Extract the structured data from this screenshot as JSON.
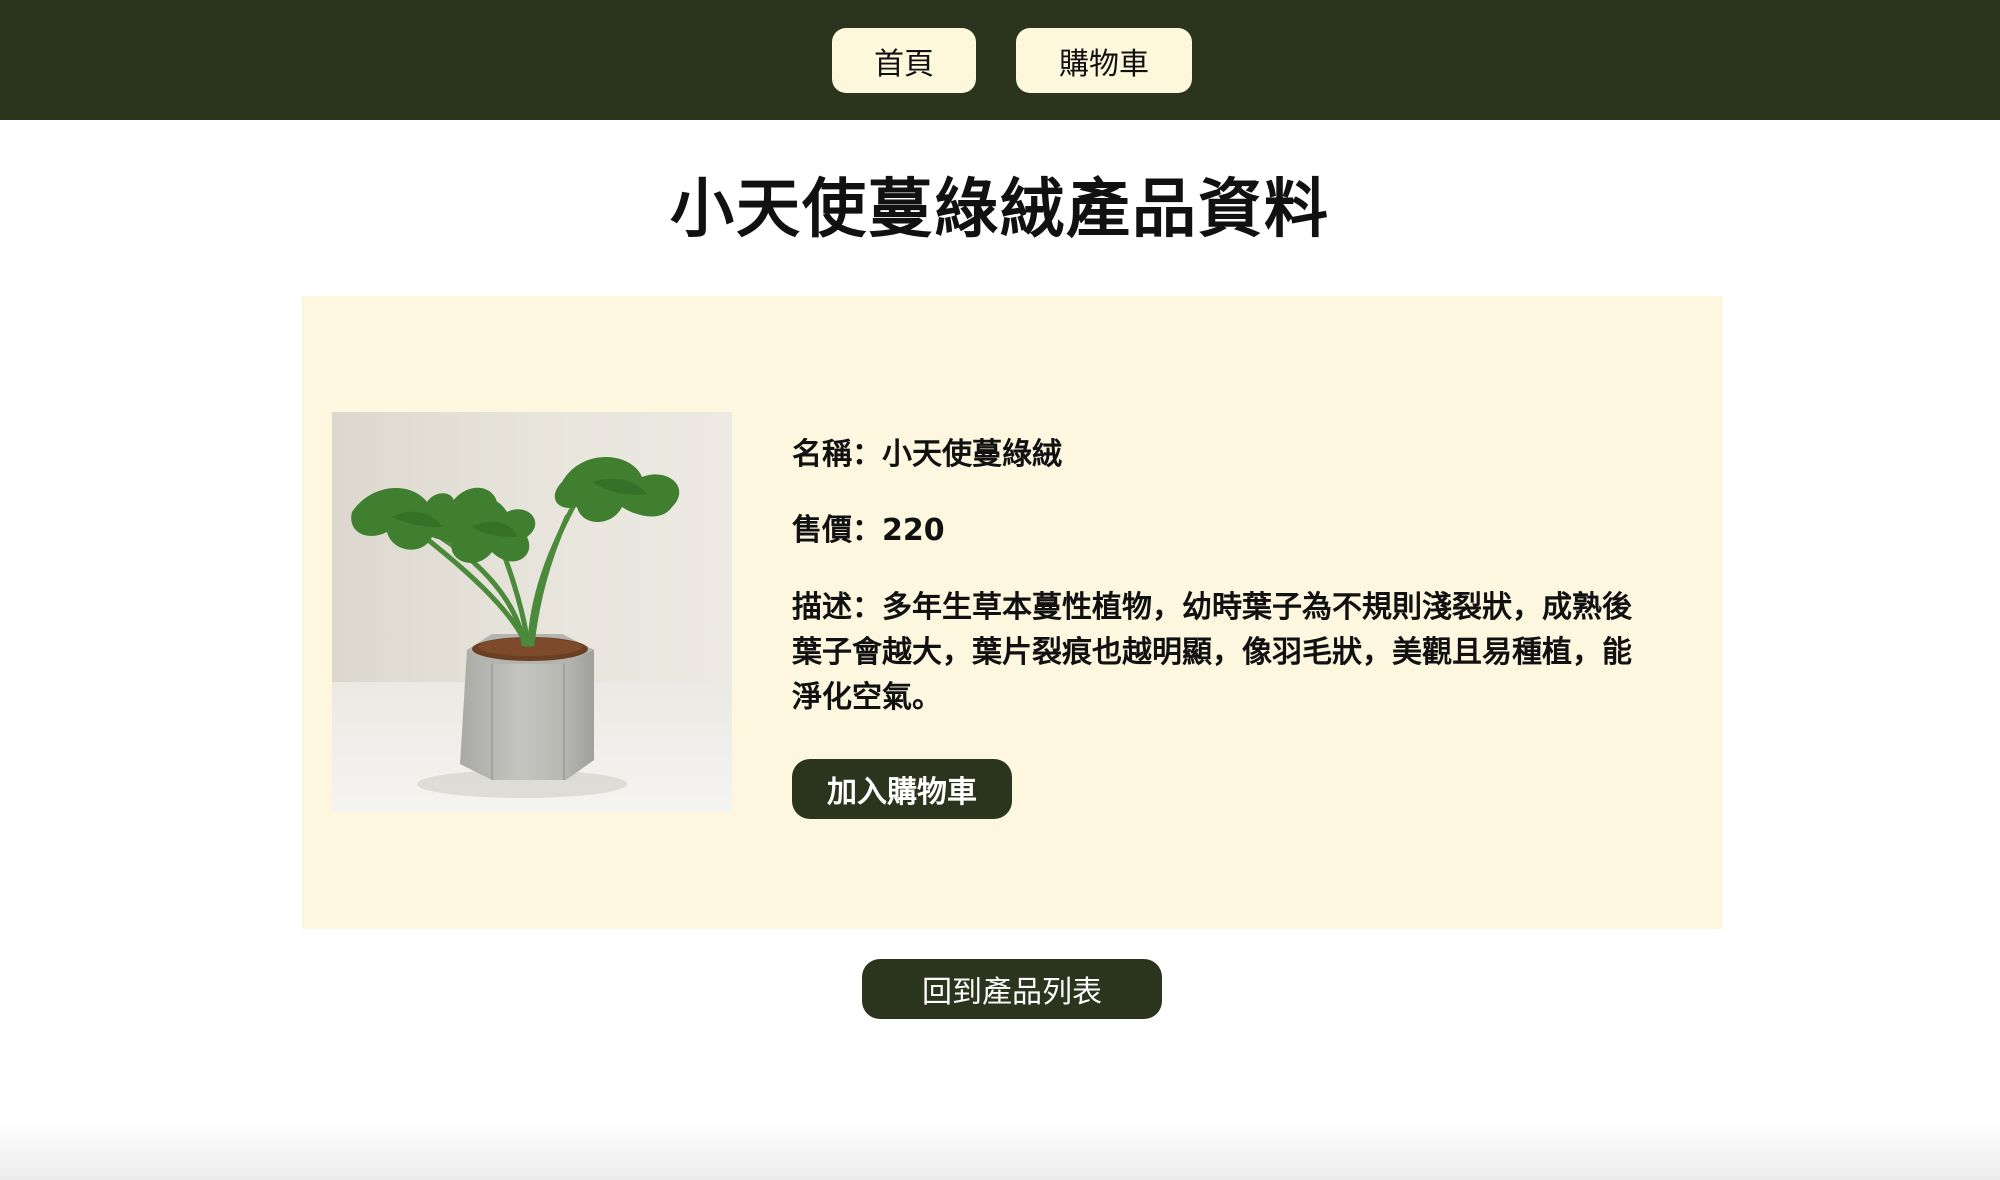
{
  "nav": {
    "home_label": "首頁",
    "cart_label": "購物車"
  },
  "page": {
    "title": "小天使蔓綠絨產品資料"
  },
  "product": {
    "name_line": "名稱：小天使蔓綠絨",
    "price_line": "售價：220",
    "description_line": "描述：多年生草本蔓性植物，幼時葉子為不規則淺裂狀，成熟後葉子會越大，葉片裂痕也越明顯，像羽毛狀，美觀且易種植，能淨化空氣。",
    "add_to_cart_label": "加入購物車",
    "image_icon": "potted-plant-image"
  },
  "footer": {
    "back_label": "回到產品列表"
  },
  "colors": {
    "header_bg": "#2b341c",
    "nav_button_bg": "#fdf7dc",
    "card_bg": "#fdf7df",
    "primary_button_bg": "#2b341c",
    "primary_button_text": "#ffffff"
  }
}
